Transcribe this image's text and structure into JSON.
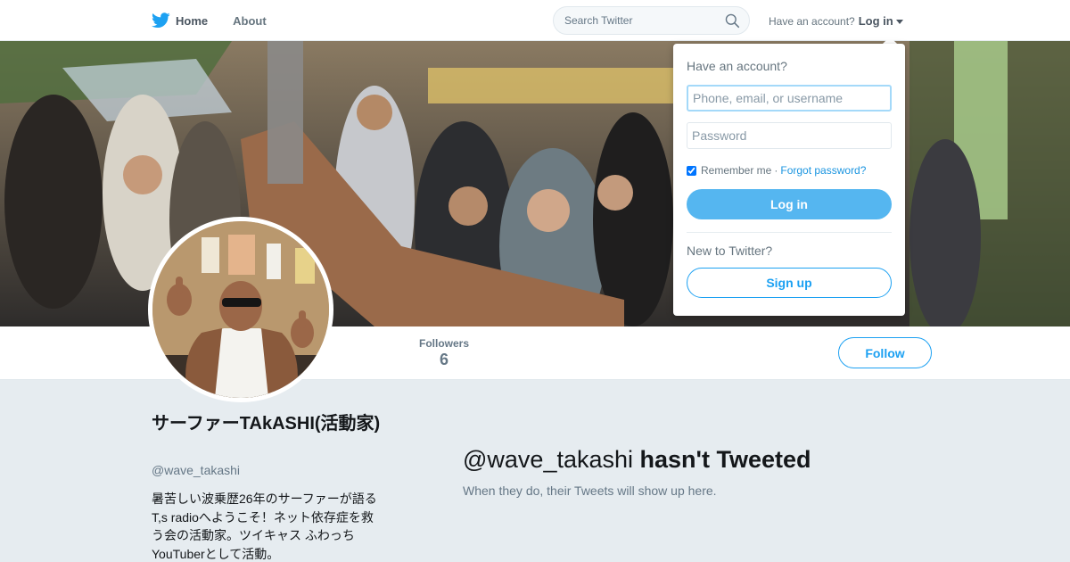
{
  "topbar": {
    "nav": [
      {
        "label": "Home",
        "icon": "twitter-bird-icon"
      },
      {
        "label": "About"
      }
    ],
    "search": {
      "placeholder": "Search Twitter",
      "icon": "search-icon"
    },
    "account_prompt": "Have an account?",
    "login_label": "Log in"
  },
  "banner": {
    "description_icon": "crowd-street-photo"
  },
  "profile": {
    "name": "サーファーTAkASHI(活動家)",
    "handle": "@wave_takashi",
    "bio": "暑苦しい波乗歴26年のサーファーが語るT,s radioへようこそ！ネット依存症を救う会の活動家。ツイキャス ふわっち YouTuberとして活動。",
    "followers_label": "Followers",
    "followers_count": "6",
    "follow_label": "Follow"
  },
  "empty_state": {
    "handle": "@wave_takashi",
    "title_suffix": "hasn't Tweeted",
    "subtitle": "When they do, their Tweets will show up here."
  },
  "login_dropdown": {
    "title": "Have an account?",
    "username_placeholder": "Phone, email, or username",
    "password_placeholder": "Password",
    "remember_label": "Remember me",
    "separator": "·",
    "forgot_label": "Forgot password?",
    "remember_checked": true,
    "login_button": "Log in",
    "new_prompt": "New to Twitter?",
    "signup_button": "Sign up"
  },
  "colors": {
    "accent": "#1da1f2",
    "login_button": "#55b6f0",
    "page_background": "#e6ecf0"
  }
}
